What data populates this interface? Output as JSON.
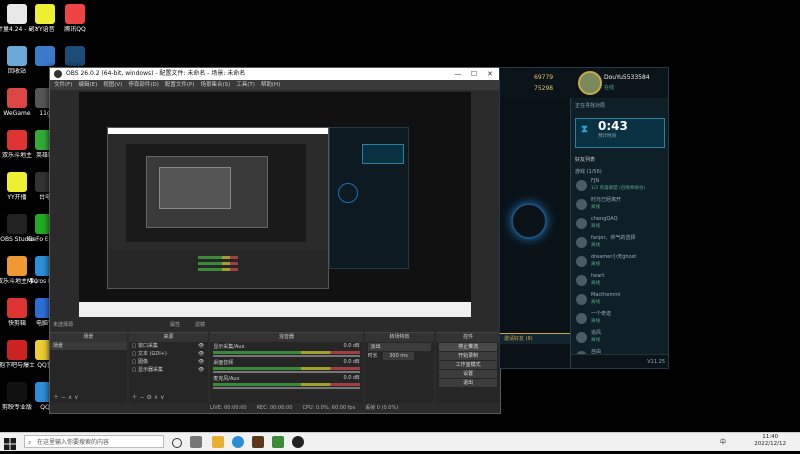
{
  "desktop": {
    "icons": [
      {
        "label": "计量4.24 - 副本111",
        "color": "#e8e8e8"
      },
      {
        "label": "回收站",
        "color": "#6aa8d8"
      },
      {
        "label": "WeGame",
        "color": "#d44"
      },
      {
        "label": "双乐斗地主",
        "color": "#d33"
      },
      {
        "label": "YY开播",
        "color": "#ee3"
      },
      {
        "label": "OBS Studio",
        "color": "#222"
      },
      {
        "label": "双乐斗地主 手游吧超级",
        "color": "#e93"
      },
      {
        "label": "快剪辑",
        "color": "#d33"
      },
      {
        "label": "抱下吧与爆士",
        "color": "#c22"
      },
      {
        "label": "剪映专业版",
        "color": "#111"
      }
    ],
    "icons_col2": [
      {
        "label": "YY语音",
        "color": "#ee3"
      },
      {
        "label": "",
        "color": "#3a7ac8"
      },
      {
        "label": "11g",
        "color": "#555"
      },
      {
        "label": "英雄联",
        "color": "#3a3"
      },
      {
        "label": "台电",
        "color": "#333"
      },
      {
        "label": "GeFo Exper",
        "color": "#2a2"
      },
      {
        "label": "Micros Edge",
        "color": "#2a8fd8"
      },
      {
        "label": "电脑管",
        "color": "#2c6ed8"
      },
      {
        "label": "QQ音",
        "color": "#ec3"
      },
      {
        "label": "QQ",
        "color": "#2a8fd8"
      }
    ],
    "icons_col3": [
      {
        "label": "腾讯QQ",
        "color": "#e44"
      },
      {
        "label": "",
        "color": "#1b4d78"
      }
    ]
  },
  "obs": {
    "title": "OBS 26.0.2 (64-bit, windows) - 配置文件: 未命名 - 场景: 未命名",
    "menu": [
      "文件(F)",
      "编辑(E)",
      "视图(V)",
      "停靠部件(D)",
      "配置文件(P)",
      "场景集合(S)",
      "工具(T)",
      "帮助(H)"
    ],
    "source_bar": "未选择源",
    "source_bar_btns": [
      "属性",
      "滤镜"
    ],
    "scenes": {
      "header": "场景",
      "items": [
        "场景"
      ]
    },
    "sources": {
      "header": "来源",
      "items": [
        "窗口采集",
        "文本 (GDI+)",
        "图像",
        "显示器采集"
      ]
    },
    "mixer": {
      "header": "混音器",
      "channels": [
        {
          "name": "显示采集/Aux",
          "db": "0.0 dB"
        },
        {
          "name": "桌面音频",
          "db": "0.0 dB"
        },
        {
          "name": "麦克风/Aux",
          "db": "0.0 dB"
        }
      ]
    },
    "transitions": {
      "header": "转场特效",
      "type": "淡出",
      "duration_label": "时长",
      "duration": "300 ms"
    },
    "controls": {
      "header": "控件",
      "buttons": [
        "停止推流",
        "开始录制",
        "工作室模式",
        "设置",
        "退出"
      ]
    },
    "status": {
      "live": "LIVE: 00:00:00",
      "rec": "REC: 00:00:00",
      "cpu": "CPU: 0.0%, 60.00 fps",
      "kbps": "延迟",
      "frames": "丢帧 0 (0.0%)"
    }
  },
  "client": {
    "currency1": "69779",
    "currency2": "75298",
    "username": "DouYu5533584",
    "status": "在线",
    "queue_label": "正在寻找对局",
    "timer": "0:43",
    "timer_sub": "预计时间",
    "friends_header": "好友列表",
    "group_label": "游戏 (1/56)",
    "friends": [
      {
        "name": "FJN",
        "status": "1/2 英雄联盟 (召唤师峡谷)"
      },
      {
        "name": "时光已经离开",
        "status": "离线"
      },
      {
        "name": "chengQAQ",
        "status": "离线"
      },
      {
        "name": "fanjer、帅气的选择",
        "status": "离线"
      },
      {
        "name": "dreamer小天ghost",
        "status": "离线"
      },
      {
        "name": "heart",
        "status": "离线"
      },
      {
        "name": "Macthemmi",
        "status": "离线"
      },
      {
        "name": "一个奇迹",
        "status": "离线"
      },
      {
        "name": "追风",
        "status": "离线"
      },
      {
        "name": "自由",
        "status": "离线"
      }
    ],
    "bottom_label": "邀请好友",
    "bottom_count": "(8)",
    "version": "V11.25"
  },
  "taskbar": {
    "search_placeholder": "在这里输入你要搜索的内容",
    "time": "11:40",
    "date": "2022/12/12",
    "lang": "中"
  }
}
